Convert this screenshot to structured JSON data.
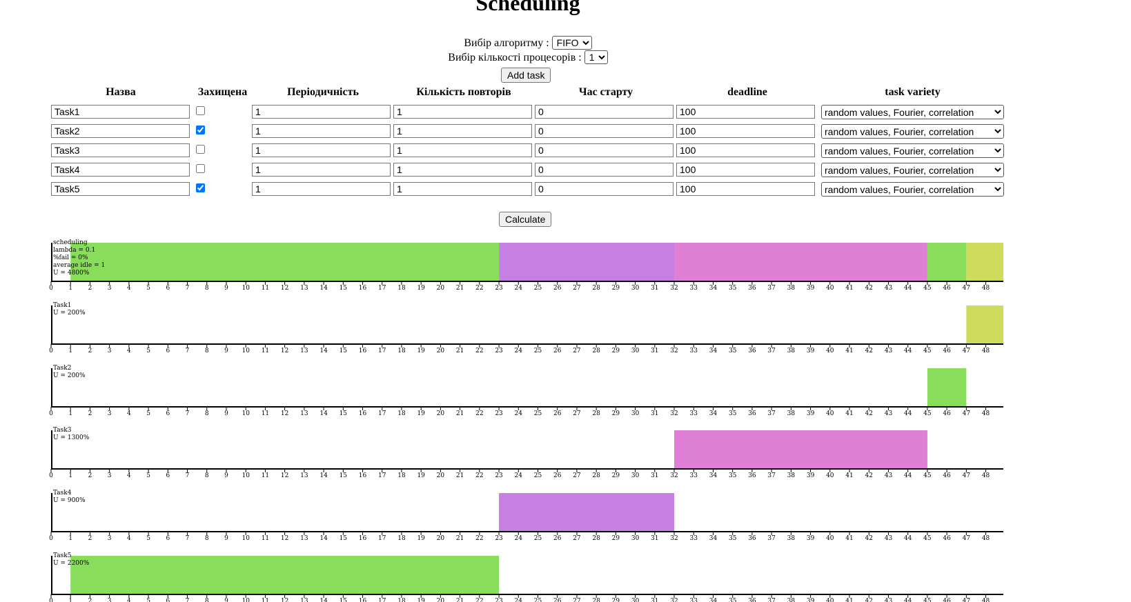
{
  "page": {
    "title": "Scheduling"
  },
  "controls": {
    "algorithm_label": "Вибір алгоритму :",
    "algorithm_value": "FIFO",
    "processors_label": "Вибір кількості процесорів :",
    "processors_value": "1",
    "add_task_label": "Add task",
    "calculate_label": "Calculate"
  },
  "table": {
    "headers": [
      "Назва",
      "Захищена",
      "Періодичність",
      "Кількість повторів",
      "Час старту",
      "deadline",
      "task variety"
    ],
    "rows": [
      {
        "name": "Task1",
        "protected": false,
        "periodicity": "1",
        "repeats": "1",
        "start": "0",
        "deadline": "100",
        "variety": "random values, Fourier, correlation"
      },
      {
        "name": "Task2",
        "protected": true,
        "periodicity": "1",
        "repeats": "1",
        "start": "0",
        "deadline": "100",
        "variety": "random values, Fourier, correlation"
      },
      {
        "name": "Task3",
        "protected": false,
        "periodicity": "1",
        "repeats": "1",
        "start": "0",
        "deadline": "100",
        "variety": "random values, Fourier, correlation"
      },
      {
        "name": "Task4",
        "protected": false,
        "periodicity": "1",
        "repeats": "1",
        "start": "0",
        "deadline": "100",
        "variety": "random values, Fourier, correlation"
      },
      {
        "name": "Task5",
        "protected": true,
        "periodicity": "1",
        "repeats": "1",
        "start": "0",
        "deadline": "100",
        "variety": "random values, Fourier, correlation"
      }
    ]
  },
  "chart_data": {
    "type": "gantt",
    "x_ticks": [
      0,
      1,
      2,
      3,
      4,
      5,
      6,
      7,
      8,
      9,
      10,
      11,
      12,
      13,
      14,
      15,
      16,
      17,
      18,
      19,
      20,
      21,
      22,
      23,
      24,
      25,
      26,
      27,
      28,
      29,
      30,
      31,
      32,
      33,
      34,
      35,
      36,
      37,
      38,
      39,
      40,
      41,
      42,
      43,
      44,
      45,
      46,
      47,
      48
    ],
    "xlim": [
      0,
      48.9
    ],
    "colors": {
      "Task1": "#cddc5a",
      "Task2": "#88dd5a",
      "Task3": "#e07fd6",
      "Task4": "#c87fe2",
      "Task5": "#88dd5a"
    },
    "panels": [
      {
        "labels": [
          "scheduling",
          "lambda = 0.1",
          "%fail = 0%",
          "average idle = 1",
          "U = 4800%"
        ],
        "segments": [
          {
            "task": "Task5",
            "start": 1,
            "end": 23
          },
          {
            "task": "Task4",
            "start": 23,
            "end": 32
          },
          {
            "task": "Task3",
            "start": 32,
            "end": 45
          },
          {
            "task": "Task2",
            "start": 45,
            "end": 47
          },
          {
            "task": "Task1",
            "start": 47,
            "end": 48.9
          }
        ]
      },
      {
        "labels": [
          "Task1",
          "U = 200%"
        ],
        "segments": [
          {
            "task": "Task1",
            "start": 47,
            "end": 48.9
          }
        ]
      },
      {
        "labels": [
          "Task2",
          "U = 200%"
        ],
        "segments": [
          {
            "task": "Task2",
            "start": 45,
            "end": 47
          }
        ]
      },
      {
        "labels": [
          "Task3",
          "U = 1300%"
        ],
        "segments": [
          {
            "task": "Task3",
            "start": 32,
            "end": 45
          }
        ]
      },
      {
        "labels": [
          "Task4",
          "U = 900%"
        ],
        "segments": [
          {
            "task": "Task4",
            "start": 23,
            "end": 32
          }
        ]
      },
      {
        "labels": [
          "Task5",
          "U = 2200%"
        ],
        "segments": [
          {
            "task": "Task5",
            "start": 1,
            "end": 23
          }
        ]
      }
    ]
  }
}
